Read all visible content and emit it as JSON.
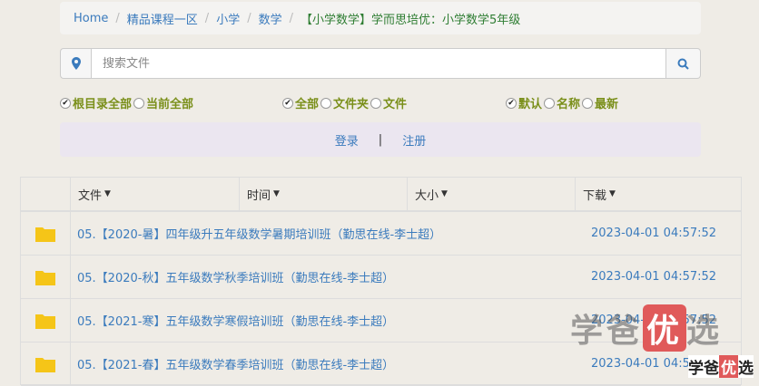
{
  "breadcrumb": {
    "items": [
      "Home",
      "精品课程一区",
      "小学",
      "数学"
    ],
    "active": "【小学数学】学而思培优：小学数学5年级"
  },
  "search": {
    "placeholder": "搜索文件",
    "value": ""
  },
  "icons": {
    "location": "map-marker-icon",
    "search": "search-icon",
    "folder": "folder-icon"
  },
  "filters": {
    "scope": [
      {
        "label": "根目录全部",
        "checked": true
      },
      {
        "label": "当前全部",
        "checked": false
      }
    ],
    "type": [
      {
        "label": "全部",
        "checked": true
      },
      {
        "label": "文件夹",
        "checked": false
      },
      {
        "label": "文件",
        "checked": false
      }
    ],
    "sort": [
      {
        "label": "默认",
        "checked": true
      },
      {
        "label": "名称",
        "checked": false
      },
      {
        "label": "最新",
        "checked": false
      }
    ]
  },
  "auth": {
    "login": "登录",
    "separator": "|",
    "register": "注册"
  },
  "table": {
    "headers": [
      "文件",
      "时间",
      "大小",
      "下载"
    ],
    "rows": [
      {
        "name": "05.【2020-暑】四年级升五年级数学暑期培训班（勤思在线-李士超）",
        "time": "2023-04-01 04:57:52"
      },
      {
        "name": "05.【2020-秋】五年级数学秋季培训班（勤思在线-李士超）",
        "time": "2023-04-01 04:57:52"
      },
      {
        "name": "05.【2021-寒】五年级数学寒假培训班（勤思在线-李士超）",
        "time": "2023-04-01 04:57:52"
      },
      {
        "name": "05.【2021-春】五年级数学春季培训班（勤思在线-李士超）",
        "time": "2023-04-01 04:57:52"
      }
    ]
  },
  "watermark": {
    "text1": "学爸",
    "highlight": "优",
    "text2": "选"
  },
  "colors": {
    "link": "#3b7bbd",
    "filter_text": "#7a8f1a",
    "folder": "#f5c518",
    "active_crumb": "#2e7d32"
  }
}
